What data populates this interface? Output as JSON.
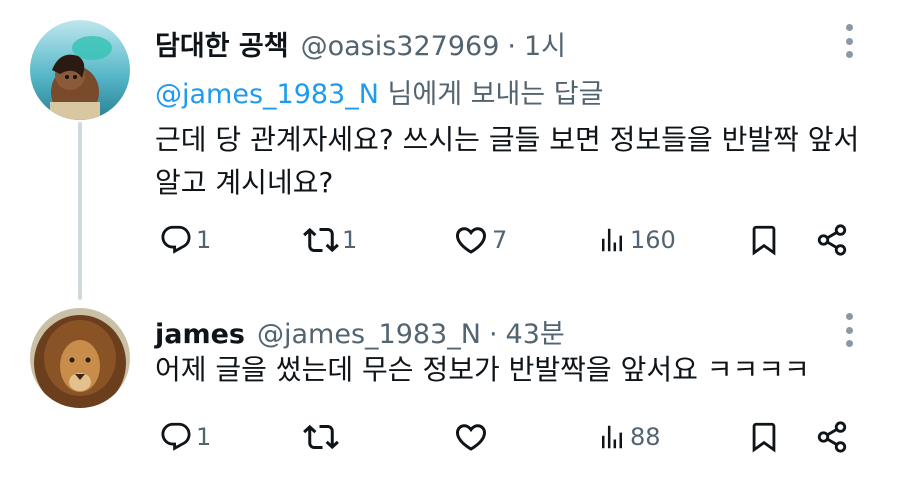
{
  "tweets": [
    {
      "name": "담대한 공책",
      "handle": "@oasis327969",
      "separator": "·",
      "time": "1시",
      "reply_mention": "@james_1983_N",
      "reply_suffix": " 님에게 보내는 답글",
      "text": "근데 당 관계자세요? 쓰시는 글들 보면 정보들을 반발짝 앞서 알고 계시네요?",
      "avatar": "moana-avatar",
      "actions": {
        "replies": "1",
        "retweets": "1",
        "likes": "7",
        "views": "160"
      }
    },
    {
      "name": "james",
      "handle": "@james_1983_N",
      "separator": "·",
      "time": "43분",
      "text": "어제 글을 썼는데 무슨 정보가 반발짝을 앞서요 ㅋㅋㅋㅋ",
      "avatar": "lion-avatar",
      "actions": {
        "replies": "1",
        "retweets": "",
        "likes": "",
        "views": "88"
      }
    }
  ],
  "colors": {
    "text": "#0f1419",
    "secondary": "#536471",
    "link": "#1d9bf0",
    "thread_line": "#cfd9de"
  },
  "icons": [
    "reply-icon",
    "retweet-icon",
    "like-icon",
    "views-icon",
    "bookmark-icon",
    "share-icon",
    "more-icon"
  ]
}
